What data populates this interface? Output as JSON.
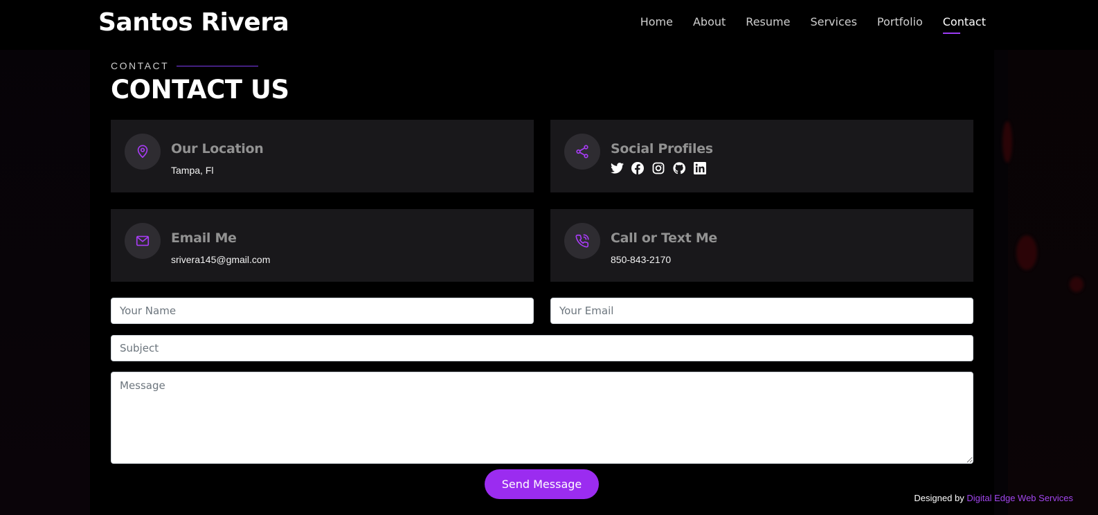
{
  "site": {
    "logo": "Santos Rivera"
  },
  "nav": {
    "items": [
      "Home",
      "About",
      "Resume",
      "Services",
      "Portfolio",
      "Contact"
    ],
    "active": "Contact"
  },
  "section": {
    "label": "CONTACT",
    "title": "CONTACT US"
  },
  "cards": {
    "location": {
      "title": "Our Location",
      "value": "Tampa, Fl",
      "icon": "map-pin-icon"
    },
    "social": {
      "title": "Social Profiles",
      "icon": "share-icon",
      "links": [
        "twitter-icon",
        "facebook-icon",
        "instagram-icon",
        "github-icon",
        "linkedin-icon"
      ]
    },
    "email": {
      "title": "Email Me",
      "value": "srivera145@gmail.com",
      "icon": "envelope-icon"
    },
    "phone": {
      "title": "Call or Text Me",
      "value": "850-843-2170",
      "icon": "phone-icon"
    }
  },
  "form": {
    "name_placeholder": "Your Name",
    "email_placeholder": "Your Email",
    "subject_placeholder": "Subject",
    "message_placeholder": "Message",
    "submit_label": "Send Message"
  },
  "footer": {
    "designed_by": "Designed by",
    "credit_link": "Digital Edge Web Services"
  },
  "colors": {
    "accent": "#9b2cf0",
    "card": "#19181b",
    "background": "#000000"
  }
}
